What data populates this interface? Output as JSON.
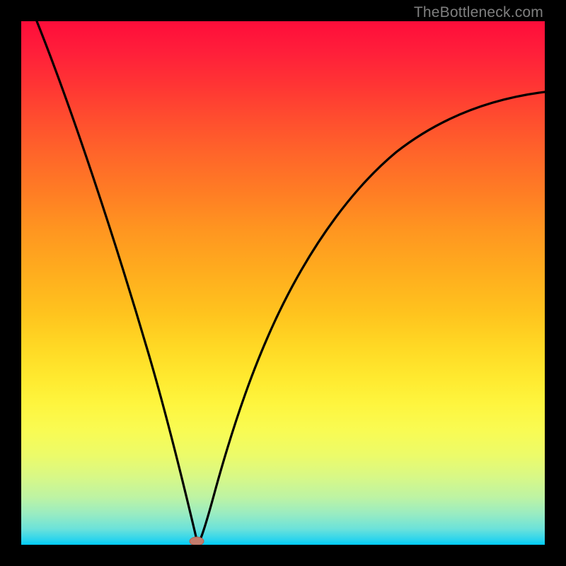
{
  "watermark": "TheBottleneck.com",
  "colors": {
    "frame": "#000000",
    "curve": "#000000",
    "marker_fill": "#c37c6d",
    "marker_stroke": "#b6604e"
  },
  "chart_data": {
    "type": "line",
    "title": "",
    "xlabel": "",
    "ylabel": "",
    "xlim": [
      0,
      1
    ],
    "ylim": [
      0,
      1
    ],
    "note": "Qualitative V-shaped curve over rainbow heat gradient; no visible axis ticks or numeric labels.",
    "x": [
      0.03,
      0.06,
      0.09,
      0.12,
      0.15,
      0.18,
      0.22,
      0.25,
      0.28,
      0.3,
      0.32,
      0.34,
      0.36,
      0.38,
      0.4,
      0.44,
      0.48,
      0.52,
      0.56,
      0.6,
      0.66,
      0.72,
      0.8,
      0.88,
      0.96,
      1.0
    ],
    "y": [
      1.0,
      0.88,
      0.76,
      0.64,
      0.52,
      0.41,
      0.29,
      0.18,
      0.08,
      0.03,
      0.005,
      0.0,
      0.02,
      0.07,
      0.15,
      0.3,
      0.42,
      0.52,
      0.59,
      0.65,
      0.71,
      0.76,
      0.8,
      0.83,
      0.85,
      0.86
    ],
    "marker": {
      "x": 0.335,
      "y": 0.004
    }
  }
}
